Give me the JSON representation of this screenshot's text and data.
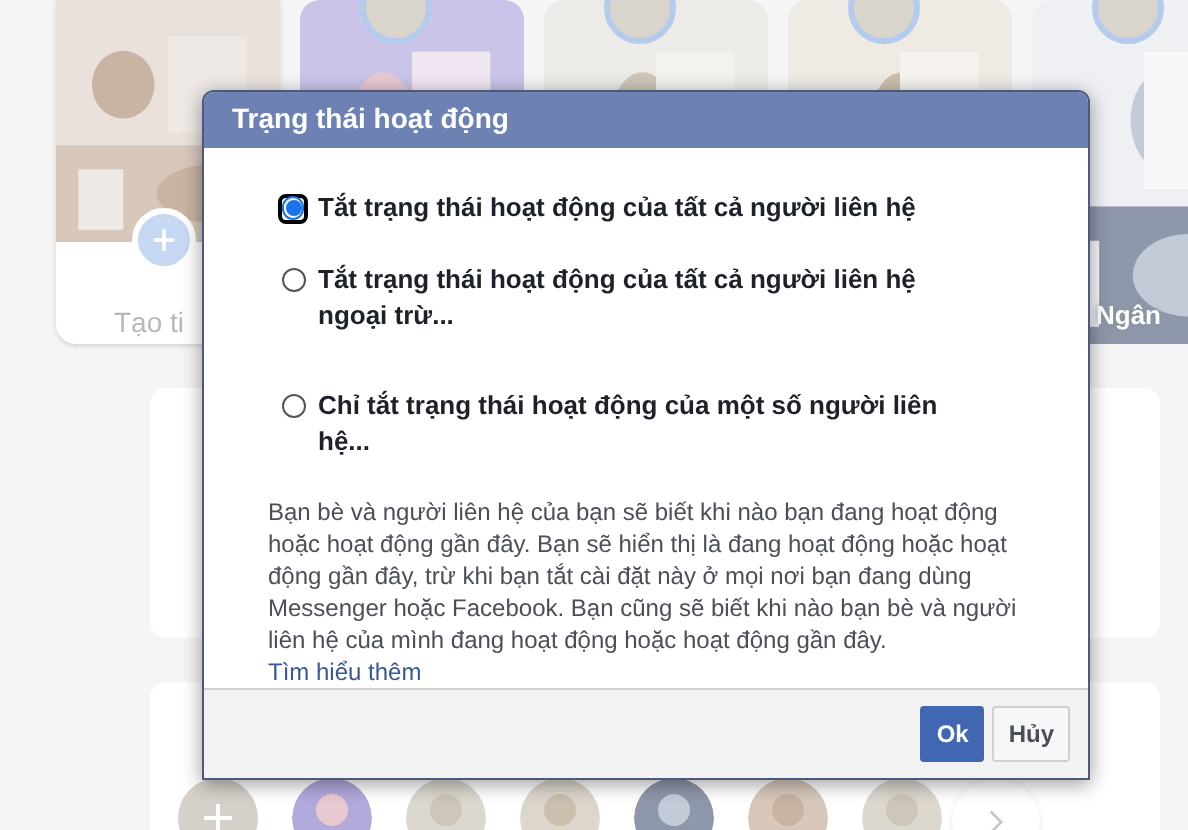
{
  "background": {
    "stories": [
      {
        "kind": "create",
        "label": "Tạo ti"
      },
      {
        "kind": "picture"
      },
      {
        "kind": "picture"
      },
      {
        "kind": "picture"
      },
      {
        "kind": "picture",
        "label": "Ngân"
      }
    ]
  },
  "dialog": {
    "title": "Trạng thái hoạt động",
    "options": [
      {
        "label": "Tắt trạng thái hoạt động của tất cả người liên hệ",
        "selected": true
      },
      {
        "label": "Tắt trạng thái hoạt động của tất cả người liên hệ ngoại trừ...",
        "selected": false
      },
      {
        "label": "Chỉ tắt trạng thái hoạt động của một số người liên hệ...",
        "selected": false
      }
    ],
    "description": "Bạn bè và người liên hệ của bạn sẽ biết khi nào bạn đang hoạt động hoặc hoạt động gần đây. Bạn sẽ hiển thị là đang hoạt động hoặc hoạt động gần đây, trừ khi bạn tắt cài đặt này ở mọi nơi bạn đang dùng Messenger hoặc Facebook. Bạn cũng sẽ biết khi nào bạn bè và người liên hệ của mình đang hoạt động hoặc hoạt động gần đây.",
    "link": "Tìm hiểu thêm",
    "buttons": [
      {
        "label": "Ok",
        "kind": "primary"
      },
      {
        "label": "Hủy",
        "kind": "secondary"
      }
    ]
  }
}
